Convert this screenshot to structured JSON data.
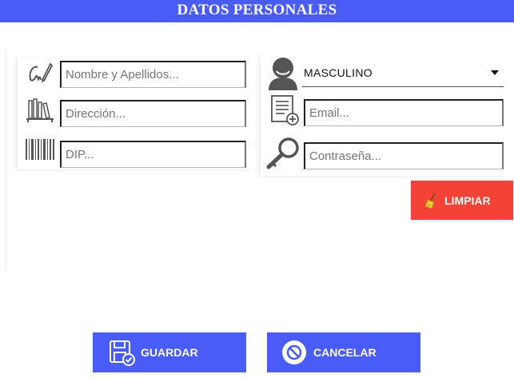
{
  "header": {
    "title": "DATOS PERSONALES"
  },
  "form": {
    "nombre": {
      "placeholder": "Nombre y Apellidos...",
      "icon": "signature-icon"
    },
    "direccion": {
      "placeholder": "Dirección...",
      "icon": "books-icon"
    },
    "dip": {
      "placeholder": "DIP...",
      "icon": "barcode-icon"
    },
    "sexo": {
      "value": "MASCULINO",
      "icon": "user-avatar-icon"
    },
    "email": {
      "placeholder": "Email...",
      "icon": "document-add-icon"
    },
    "password": {
      "placeholder": "Contraseña...",
      "icon": "key-icon"
    }
  },
  "buttons": {
    "limpiar": {
      "label": "LIMPIAR",
      "icon": "broom-icon",
      "color": "#f44336"
    },
    "guardar": {
      "label": "GUARDAR",
      "icon": "save-disk-icon",
      "color": "#4a5cf7"
    },
    "cancelar": {
      "label": "CANCELAR",
      "icon": "cancel-circle-icon",
      "color": "#4a5cf7"
    }
  },
  "colors": {
    "accent": "#4a5cf7",
    "danger": "#f44336"
  }
}
